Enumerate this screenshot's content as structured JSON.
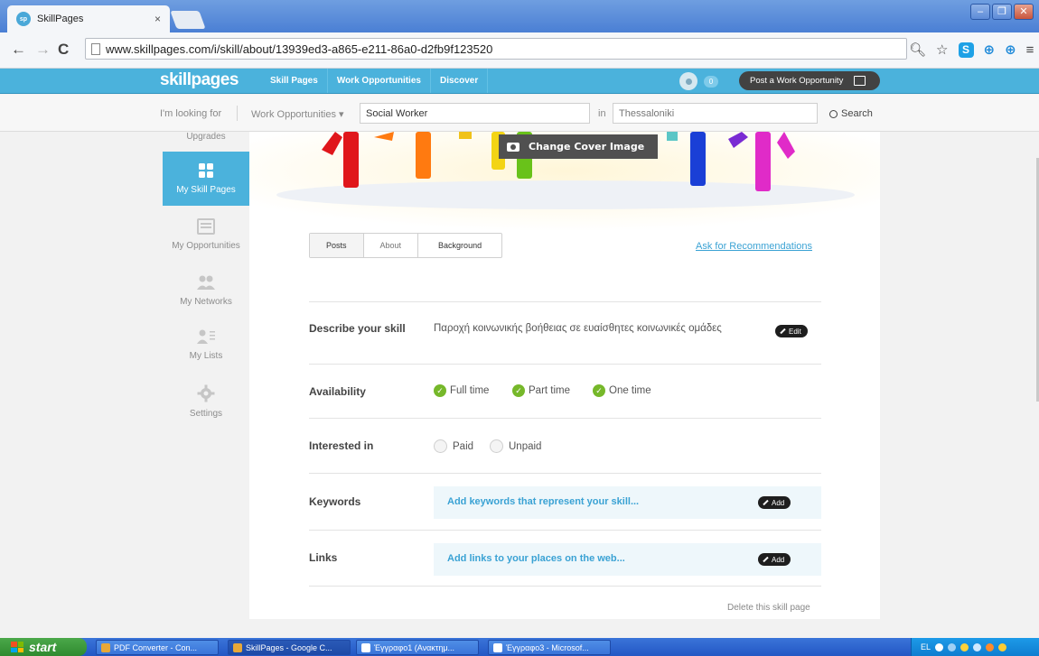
{
  "browser": {
    "tab_title": "SkillPages",
    "tab_close": "×",
    "url": "www.skillpages.com/i/skill/about/13939ed3-a865-e211-86a0-d2fb9f123520"
  },
  "site": {
    "logo": "skillpages",
    "nav": [
      "Skill Pages",
      "Work Opportunities",
      "Discover"
    ],
    "notification_count": "0",
    "post_button": "Post a Work Opportunity"
  },
  "search": {
    "looking_for_label": "I'm looking for",
    "category": "Work Opportunities",
    "query": "Social Worker",
    "in_label": "in",
    "location": "Thessaloniki",
    "search_label": "Search"
  },
  "sidebar": {
    "items": [
      {
        "label": "Upgrades"
      },
      {
        "label": "My Skill Pages"
      },
      {
        "label": "My Opportunities"
      },
      {
        "label": "My Networks"
      },
      {
        "label": "My Lists"
      },
      {
        "label": "Settings"
      }
    ]
  },
  "cover": {
    "change_label": "Change Cover Image"
  },
  "tabs": [
    "Posts",
    "About",
    "Background"
  ],
  "ask_recommendations": "Ask for Recommendations",
  "skill": {
    "describe_label": "Describe your skill",
    "describe_text": "Παροχή κοινωνικής βοήθειας σε ευαίσθητες κοινωνικές ομάδες",
    "edit_label": "Edit",
    "availability_label": "Availability",
    "availability": [
      "Full time",
      "Part time",
      "One time"
    ],
    "interested_label": "Interested in",
    "interested_options": [
      "Paid",
      "Unpaid"
    ],
    "keywords_label": "Keywords",
    "keywords_prompt": "Add keywords that represent your skill...",
    "links_label": "Links",
    "links_prompt": "Add links to your places on the web...",
    "add_label": "Add",
    "delete_label": "Delete this skill page"
  },
  "taskbar": {
    "start": "start",
    "tasks": [
      "PDF Converter - Con...",
      "SkillPages - Google C...",
      "Έγγραφο1 (Ανακτημ...",
      "Έγγραφο3 - Microsof..."
    ],
    "language": "EL"
  },
  "colors": {
    "brand": "#4bb2dc",
    "link": "#3aa2d4",
    "check": "#76b82a"
  }
}
